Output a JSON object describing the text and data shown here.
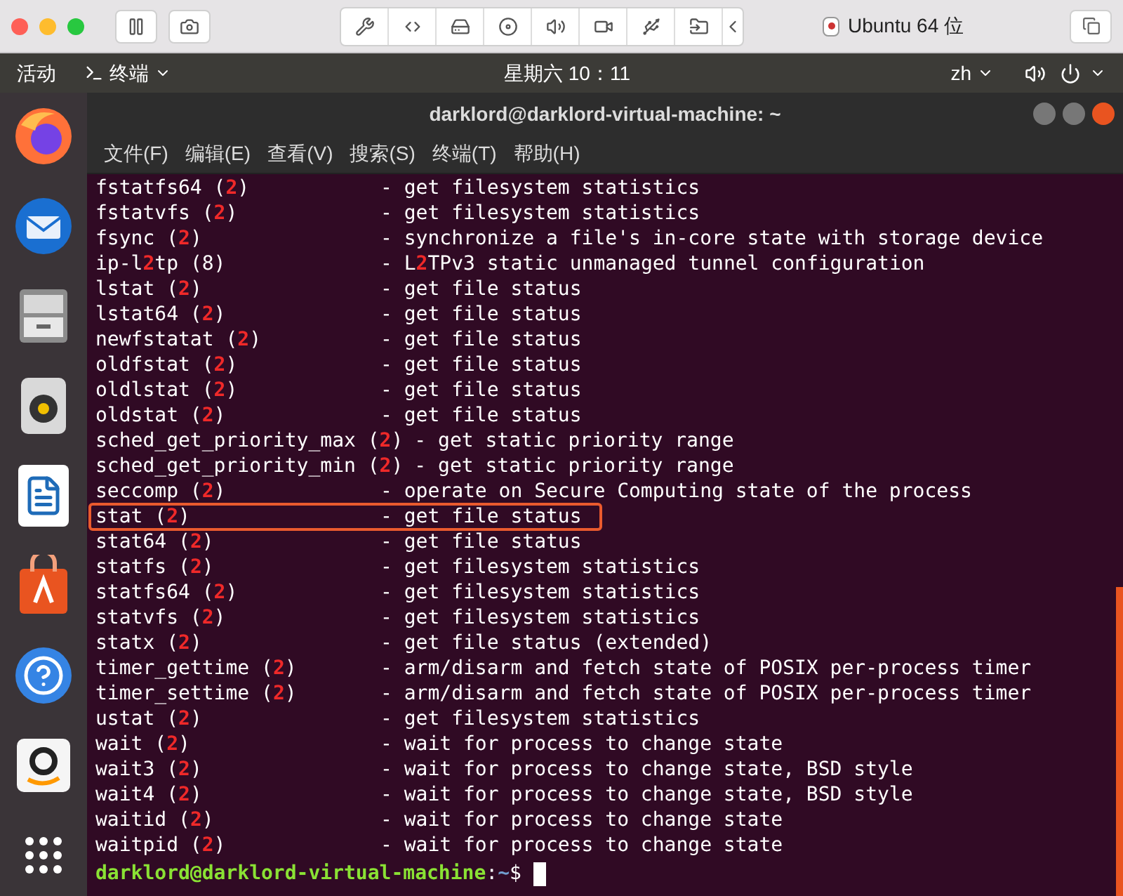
{
  "vm_window": {
    "title": "Ubuntu 64 位"
  },
  "top_bar": {
    "activities": "活动",
    "app_menu": "终端",
    "clock": "星期六 10：11",
    "input_method": "zh"
  },
  "terminal": {
    "title": "darklord@darklord-virtual-machine: ~",
    "menu": [
      "文件(F)",
      "编辑(E)",
      "查看(V)",
      "搜索(S)",
      "终端(T)",
      "帮助(H)"
    ],
    "lines": [
      {
        "name": [
          {
            "text": "fstatfs64 (",
            "match": false
          },
          {
            "text": "2",
            "match": true
          },
          {
            "text": ")",
            "match": false
          }
        ],
        "desc": [
          {
            "text": "- get filesystem statistics",
            "match": false
          }
        ],
        "highlighted": false
      },
      {
        "name": [
          {
            "text": "fstatvfs (",
            "match": false
          },
          {
            "text": "2",
            "match": true
          },
          {
            "text": ")",
            "match": false
          }
        ],
        "desc": [
          {
            "text": "- get filesystem statistics",
            "match": false
          }
        ],
        "highlighted": false
      },
      {
        "name": [
          {
            "text": "fsync (",
            "match": false
          },
          {
            "text": "2",
            "match": true
          },
          {
            "text": ")",
            "match": false
          }
        ],
        "desc": [
          {
            "text": "- synchronize a file's in-core state with storage device",
            "match": false
          }
        ],
        "highlighted": false
      },
      {
        "name": [
          {
            "text": "ip-l",
            "match": false
          },
          {
            "text": "2",
            "match": true
          },
          {
            "text": "tp (8)",
            "match": false
          }
        ],
        "desc": [
          {
            "text": "- L",
            "match": false
          },
          {
            "text": "2",
            "match": true
          },
          {
            "text": "TPv3 static unmanaged tunnel configuration",
            "match": false
          }
        ],
        "highlighted": false
      },
      {
        "name": [
          {
            "text": "lstat (",
            "match": false
          },
          {
            "text": "2",
            "match": true
          },
          {
            "text": ")",
            "match": false
          }
        ],
        "desc": [
          {
            "text": "- get file status",
            "match": false
          }
        ],
        "highlighted": false
      },
      {
        "name": [
          {
            "text": "lstat64 (",
            "match": false
          },
          {
            "text": "2",
            "match": true
          },
          {
            "text": ")",
            "match": false
          }
        ],
        "desc": [
          {
            "text": "- get file status",
            "match": false
          }
        ],
        "highlighted": false
      },
      {
        "name": [
          {
            "text": "newfstatat (",
            "match": false
          },
          {
            "text": "2",
            "match": true
          },
          {
            "text": ")",
            "match": false
          }
        ],
        "desc": [
          {
            "text": "- get file status",
            "match": false
          }
        ],
        "highlighted": false
      },
      {
        "name": [
          {
            "text": "oldfstat (",
            "match": false
          },
          {
            "text": "2",
            "match": true
          },
          {
            "text": ")",
            "match": false
          }
        ],
        "desc": [
          {
            "text": "- get file status",
            "match": false
          }
        ],
        "highlighted": false
      },
      {
        "name": [
          {
            "text": "oldlstat (",
            "match": false
          },
          {
            "text": "2",
            "match": true
          },
          {
            "text": ")",
            "match": false
          }
        ],
        "desc": [
          {
            "text": "- get file status",
            "match": false
          }
        ],
        "highlighted": false
      },
      {
        "name": [
          {
            "text": "oldstat (",
            "match": false
          },
          {
            "text": "2",
            "match": true
          },
          {
            "text": ")",
            "match": false
          }
        ],
        "desc": [
          {
            "text": "- get file status",
            "match": false
          }
        ],
        "highlighted": false
      },
      {
        "name": [
          {
            "text": "sched_get_priority_max (",
            "match": false
          },
          {
            "text": "2",
            "match": true
          },
          {
            "text": ")",
            "match": false
          }
        ],
        "desc": [
          {
            "text": "- get static priority range",
            "match": false
          }
        ],
        "highlighted": false
      },
      {
        "name": [
          {
            "text": "sched_get_priority_min (",
            "match": false
          },
          {
            "text": "2",
            "match": true
          },
          {
            "text": ")",
            "match": false
          }
        ],
        "desc": [
          {
            "text": "- get static priority range",
            "match": false
          }
        ],
        "highlighted": false
      },
      {
        "name": [
          {
            "text": "seccomp (",
            "match": false
          },
          {
            "text": "2",
            "match": true
          },
          {
            "text": ")",
            "match": false
          }
        ],
        "desc": [
          {
            "text": "- operate on Secure Computing state of the process",
            "match": false
          }
        ],
        "highlighted": false
      },
      {
        "name": [
          {
            "text": "stat (",
            "match": false
          },
          {
            "text": "2",
            "match": true
          },
          {
            "text": ")",
            "match": false
          }
        ],
        "desc": [
          {
            "text": "- get file status",
            "match": false
          }
        ],
        "highlighted": true
      },
      {
        "name": [
          {
            "text": "stat64 (",
            "match": false
          },
          {
            "text": "2",
            "match": true
          },
          {
            "text": ")",
            "match": false
          }
        ],
        "desc": [
          {
            "text": "- get file status",
            "match": false
          }
        ],
        "highlighted": false
      },
      {
        "name": [
          {
            "text": "statfs (",
            "match": false
          },
          {
            "text": "2",
            "match": true
          },
          {
            "text": ")",
            "match": false
          }
        ],
        "desc": [
          {
            "text": "- get filesystem statistics",
            "match": false
          }
        ],
        "highlighted": false
      },
      {
        "name": [
          {
            "text": "statfs64 (",
            "match": false
          },
          {
            "text": "2",
            "match": true
          },
          {
            "text": ")",
            "match": false
          }
        ],
        "desc": [
          {
            "text": "- get filesystem statistics",
            "match": false
          }
        ],
        "highlighted": false
      },
      {
        "name": [
          {
            "text": "statvfs (",
            "match": false
          },
          {
            "text": "2",
            "match": true
          },
          {
            "text": ")",
            "match": false
          }
        ],
        "desc": [
          {
            "text": "- get filesystem statistics",
            "match": false
          }
        ],
        "highlighted": false
      },
      {
        "name": [
          {
            "text": "statx (",
            "match": false
          },
          {
            "text": "2",
            "match": true
          },
          {
            "text": ")",
            "match": false
          }
        ],
        "desc": [
          {
            "text": "- get file status (extended)",
            "match": false
          }
        ],
        "highlighted": false
      },
      {
        "name": [
          {
            "text": "timer_gettime (",
            "match": false
          },
          {
            "text": "2",
            "match": true
          },
          {
            "text": ")",
            "match": false
          }
        ],
        "desc": [
          {
            "text": "- arm/disarm and fetch state of POSIX per-process timer",
            "match": false
          }
        ],
        "highlighted": false
      },
      {
        "name": [
          {
            "text": "timer_settime (",
            "match": false
          },
          {
            "text": "2",
            "match": true
          },
          {
            "text": ")",
            "match": false
          }
        ],
        "desc": [
          {
            "text": "- arm/disarm and fetch state of POSIX per-process timer",
            "match": false
          }
        ],
        "highlighted": false
      },
      {
        "name": [
          {
            "text": "ustat (",
            "match": false
          },
          {
            "text": "2",
            "match": true
          },
          {
            "text": ")",
            "match": false
          }
        ],
        "desc": [
          {
            "text": "- get filesystem statistics",
            "match": false
          }
        ],
        "highlighted": false
      },
      {
        "name": [
          {
            "text": "wait (",
            "match": false
          },
          {
            "text": "2",
            "match": true
          },
          {
            "text": ")",
            "match": false
          }
        ],
        "desc": [
          {
            "text": "- wait for process to change state",
            "match": false
          }
        ],
        "highlighted": false
      },
      {
        "name": [
          {
            "text": "wait3 (",
            "match": false
          },
          {
            "text": "2",
            "match": true
          },
          {
            "text": ")",
            "match": false
          }
        ],
        "desc": [
          {
            "text": "- wait for process to change state, BSD style",
            "match": false
          }
        ],
        "highlighted": false
      },
      {
        "name": [
          {
            "text": "wait4 (",
            "match": false
          },
          {
            "text": "2",
            "match": true
          },
          {
            "text": ")",
            "match": false
          }
        ],
        "desc": [
          {
            "text": "- wait for process to change state, BSD style",
            "match": false
          }
        ],
        "highlighted": false
      },
      {
        "name": [
          {
            "text": "waitid (",
            "match": false
          },
          {
            "text": "2",
            "match": true
          },
          {
            "text": ")",
            "match": false
          }
        ],
        "desc": [
          {
            "text": "- wait for process to change state",
            "match": false
          }
        ],
        "highlighted": false
      },
      {
        "name": [
          {
            "text": "waitpid (",
            "match": false
          },
          {
            "text": "2",
            "match": true
          },
          {
            "text": ")",
            "match": false
          }
        ],
        "desc": [
          {
            "text": "- wait for process to change state",
            "match": false
          }
        ],
        "highlighted": false
      }
    ],
    "prompt": [
      {
        "text": "darklord@darklord-virtual-machine",
        "kind": "user"
      },
      {
        "text": ":",
        "kind": "plain"
      },
      {
        "text": "~",
        "kind": "path"
      },
      {
        "text": "$",
        "kind": "plain"
      }
    ]
  }
}
